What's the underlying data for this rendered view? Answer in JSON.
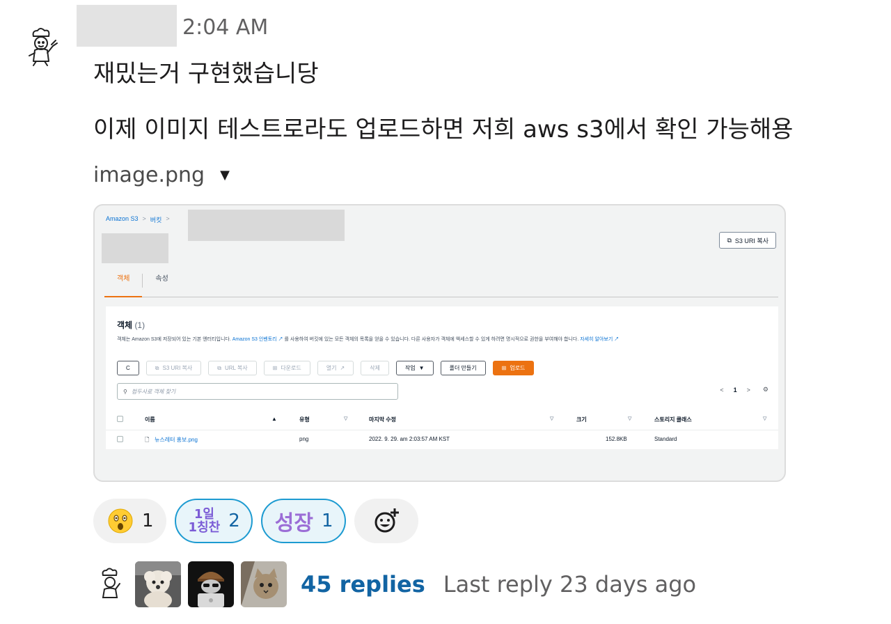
{
  "message": {
    "timestamp": "2:04 AM",
    "line1": "재밌는거 구현했습니당",
    "line2": "이제 이미지 테스트로라도 업로드하면 저희 aws s3에서 확인 가능해용",
    "attachment_name": "image.png"
  },
  "s3": {
    "breadcrumb": [
      "Amazon S3",
      "버킷"
    ],
    "copy_uri_top": "S3 URI 복사",
    "tabs": [
      "객체",
      "속성"
    ],
    "panel_title": "객체",
    "panel_count": "(1)",
    "desc_pre": "객체는 Amazon S3에 저장되어 있는 기본 엔터티입니다. ",
    "desc_link1": "Amazon S3 인벤토리",
    "desc_mid": " 를 사용하여 버킷에 있는 모든 객체의 목록을 얻을 수 있습니다. 다른 사용자가 객체에 액세스할 수 있게 하려면 명시적으로 권한을 부여해야 합니다. ",
    "desc_link2": "자세히 알아보기",
    "buttons": {
      "refresh": "C",
      "copy_s3_uri": "S3 URI 복사",
      "copy_url": "URL 복사",
      "download": "다운로드",
      "open": "열기",
      "delete": "삭제",
      "actions": "작업",
      "create_folder": "폴더 만들기",
      "upload": "업로드"
    },
    "search_placeholder": "접두사로 객체 찾기",
    "page_current": "1",
    "columns": [
      "이름",
      "유형",
      "마지막 수정",
      "크기",
      "스토리지 클래스"
    ],
    "rows": [
      {
        "name": "뉴스레터 홍보.png",
        "type": "png",
        "modified": "2022. 9. 29. am 2:03:57 AM KST",
        "size": "152.8KB",
        "storage": "Standard"
      }
    ]
  },
  "reactions": [
    {
      "emoji": "astonished-face",
      "count": "1"
    },
    {
      "emoji_text_top": "1일",
      "emoji_text_bottom": "1칭찬",
      "count": "2"
    },
    {
      "emoji_text": "성장",
      "count": "1"
    }
  ],
  "thread": {
    "replies": "45 replies",
    "last_reply": "Last reply 23 days ago"
  },
  "colors": {
    "link_blue": "#1264a3",
    "aws_orange": "#ec7211",
    "aws_link": "#0972d3"
  }
}
